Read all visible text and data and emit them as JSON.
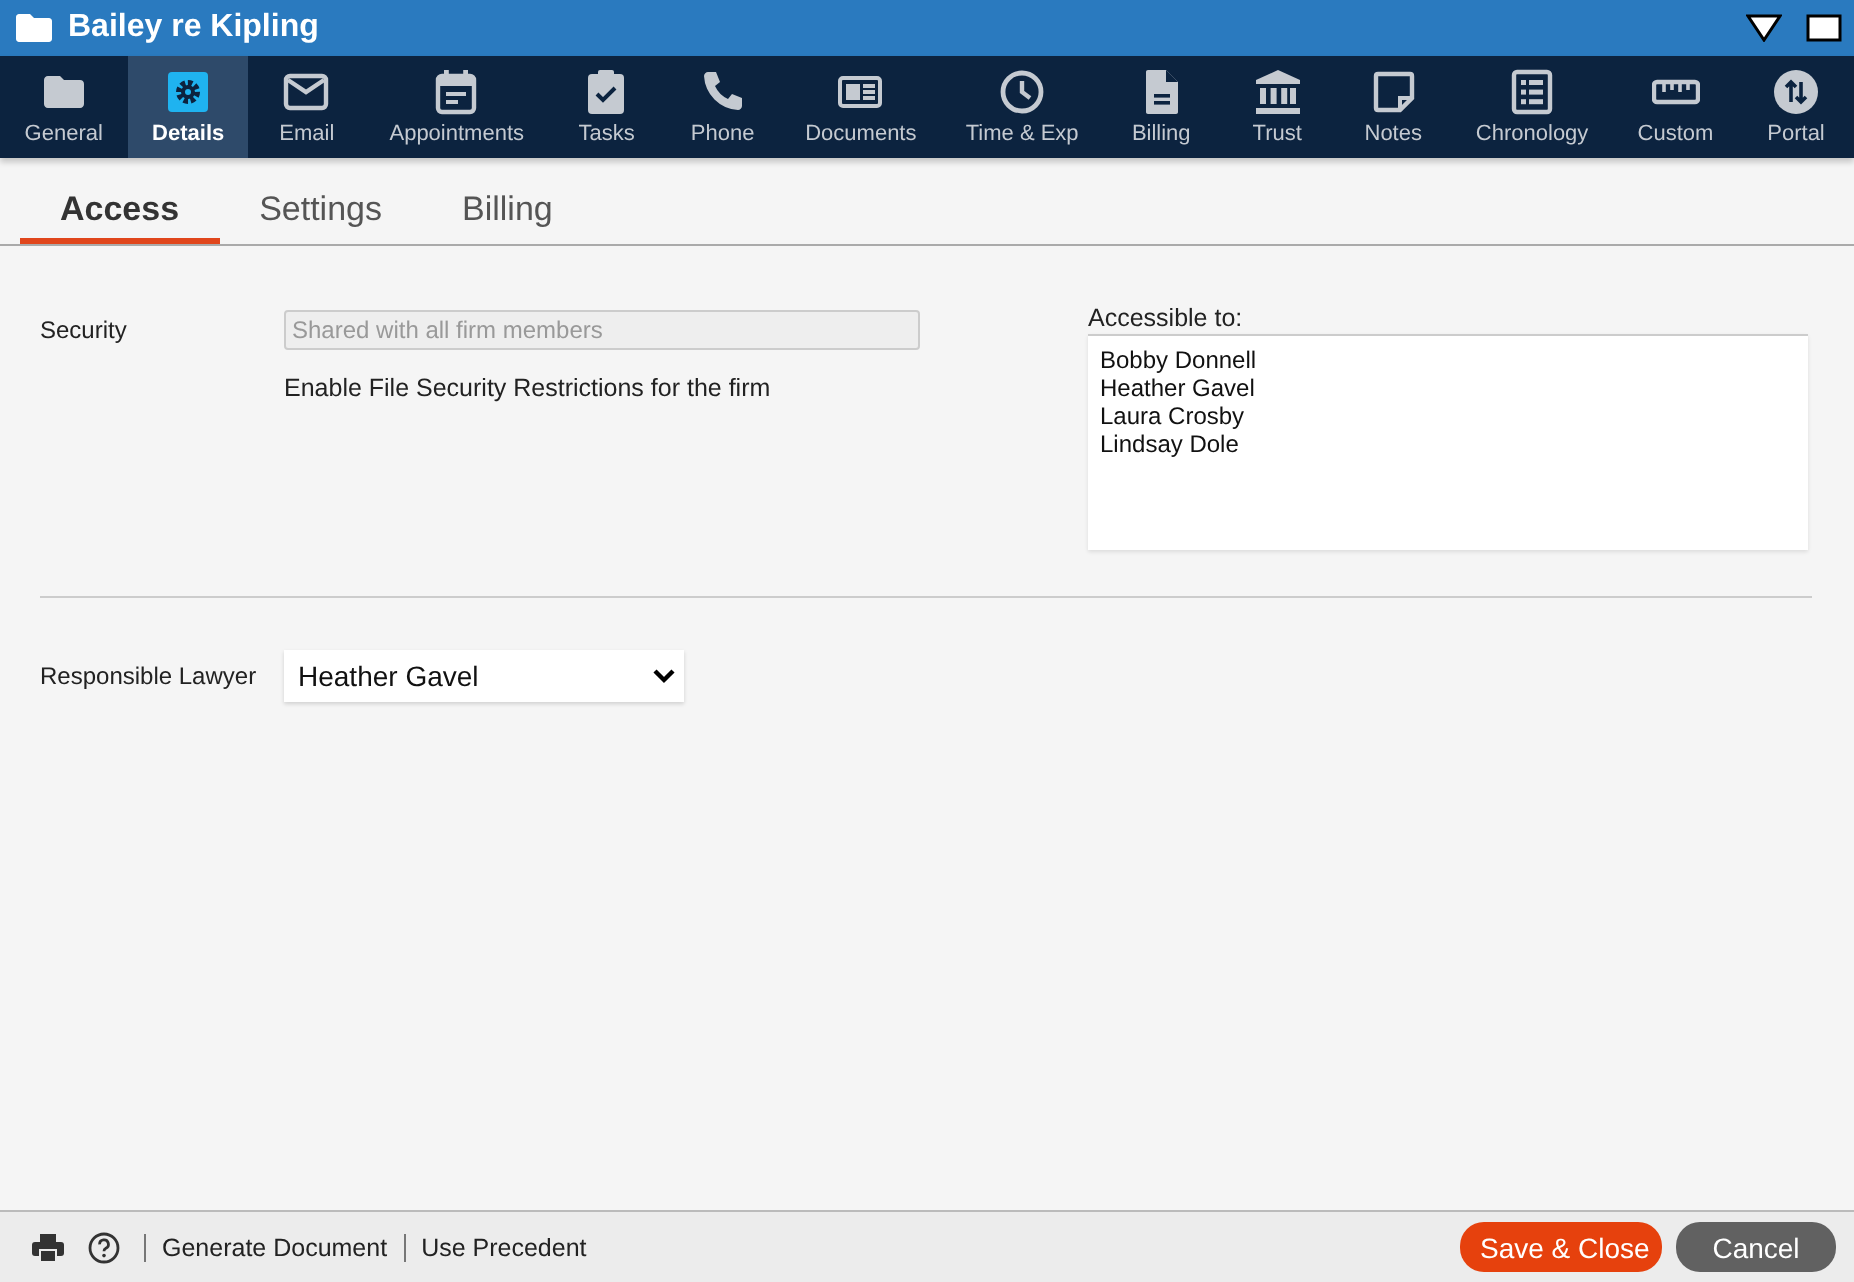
{
  "window": {
    "title": "Bailey re Kipling"
  },
  "toolbar": [
    {
      "kind": "folder",
      "label": "General",
      "selected": false
    },
    {
      "kind": "gear",
      "label": "Details",
      "selected": true
    },
    {
      "kind": "mail",
      "label": "Email",
      "selected": false
    },
    {
      "kind": "calendar",
      "label": "Appointments",
      "selected": false
    },
    {
      "kind": "clipboard",
      "label": "Tasks",
      "selected": false
    },
    {
      "kind": "phone",
      "label": "Phone",
      "selected": false
    },
    {
      "kind": "news",
      "label": "Documents",
      "selected": false
    },
    {
      "kind": "clock",
      "label": "Time & Exp",
      "selected": false
    },
    {
      "kind": "doc",
      "label": "Billing",
      "selected": false
    },
    {
      "kind": "bank",
      "label": "Trust",
      "selected": false
    },
    {
      "kind": "note",
      "label": "Notes",
      "selected": false
    },
    {
      "kind": "list",
      "label": "Chronology",
      "selected": false
    },
    {
      "kind": "ruler",
      "label": "Custom",
      "selected": false
    },
    {
      "kind": "swap",
      "label": "Portal",
      "selected": false
    }
  ],
  "tabs": [
    {
      "label": "Access",
      "selected": true
    },
    {
      "label": "Settings",
      "selected": false
    },
    {
      "label": "Billing",
      "selected": false
    }
  ],
  "security": {
    "label": "Security",
    "placeholder": "Shared with all firm members",
    "note": "Enable File Security Restrictions for the firm"
  },
  "accessible": {
    "label": "Accessible to:",
    "people": [
      "Bobby Donnell",
      "Heather Gavel",
      "Laura Crosby",
      "Lindsay Dole"
    ]
  },
  "responsible_lawyer": {
    "label": "Responsible Lawyer",
    "value": "Heather Gavel"
  },
  "footer": {
    "links": [
      "Generate Document",
      "Use Precedent"
    ],
    "buttons": [
      {
        "kind": "primary",
        "label": "Save & Close"
      },
      {
        "kind": "secondary",
        "label": "Cancel"
      }
    ]
  }
}
